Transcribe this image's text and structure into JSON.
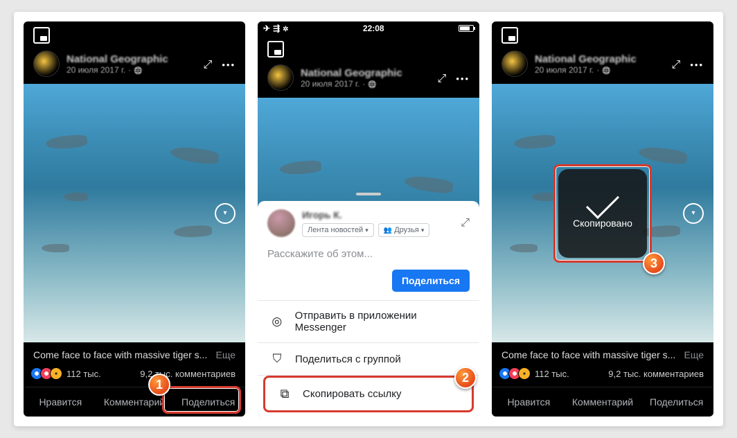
{
  "post": {
    "page_name": "National Geographic",
    "date": "20 июля 2017 г.",
    "caption": "Come face to face with massive tiger s...",
    "more_label": "Еще",
    "likes_count": "112 тыс.",
    "comments_count": "9,2 тыс. комментариев"
  },
  "actions": {
    "like": "Нравится",
    "comment": "Комментарий",
    "share": "Поделиться"
  },
  "status": {
    "time": "22:08"
  },
  "share_sheet": {
    "user_name": "Игорь К.",
    "feed_pill": "Лента новостей",
    "friends_pill": "Друзья",
    "placeholder": "Расскажите об этом...",
    "share_button": "Поделиться",
    "option_messenger": "Отправить в приложении Messenger",
    "option_group": "Поделиться с группой",
    "option_copy": "Скопировать ссылку"
  },
  "toast": {
    "copied": "Скопировано"
  },
  "markers": {
    "m1": "1",
    "m2": "2",
    "m3": "3"
  }
}
